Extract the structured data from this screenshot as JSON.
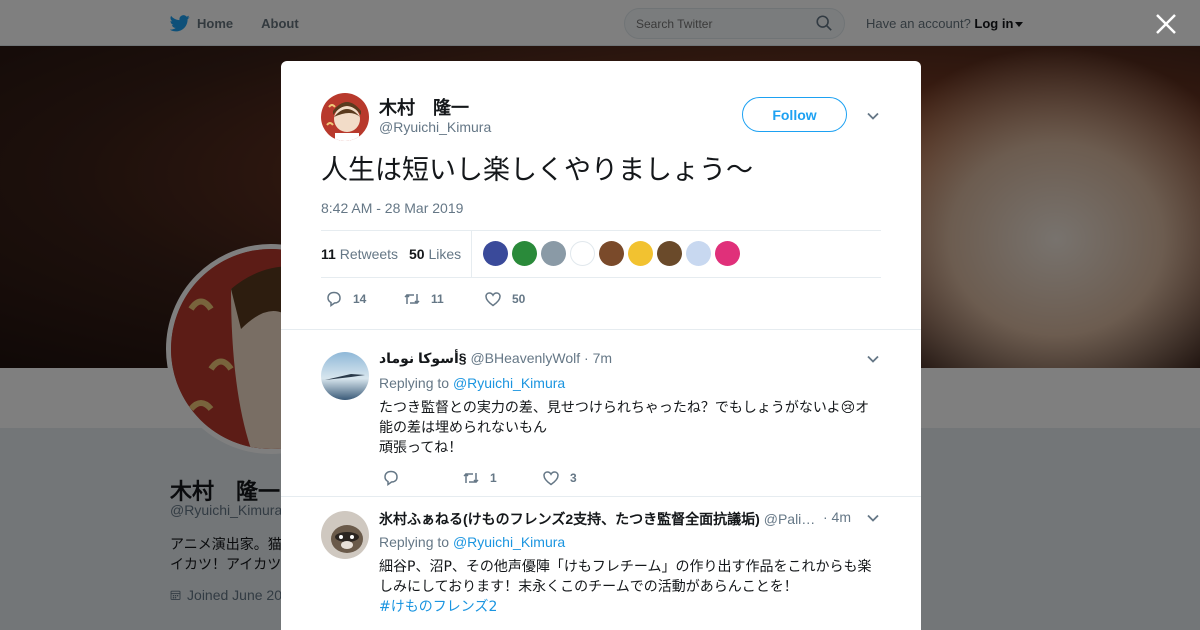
{
  "nav": {
    "home_label": "Home",
    "about_label": "About",
    "search_placeholder": "Search Twitter",
    "account_prompt": "Have an account?",
    "login_label": "Log in"
  },
  "background_profile": {
    "name": "木村　隆一",
    "handle": "@Ryuichi_Kimura",
    "bio_line1": "アニメ演出家。猫",
    "bio_line2": "イカツ！アイカツ",
    "joined": "Joined June 20"
  },
  "tweet": {
    "author_name": "木村　隆一",
    "author_handle": "@Ryuichi_Kimura",
    "follow_label": "Follow",
    "text": "人生は短いし楽しくやりましょう〜",
    "timestamp": "8:42 AM - 28 Mar 2019",
    "retweets_count": "11",
    "retweets_label": "Retweets",
    "likes_count": "50",
    "likes_label": "Likes",
    "reply_count": "14",
    "retweet_action_count": "11",
    "like_action_count": "50",
    "likers": [
      "#3a4a9a",
      "#2a8a3a",
      "#8a9aa6",
      "#ffffff",
      "#7a4a2a",
      "#f2c230",
      "#6a4a2a",
      "#c8d8f0",
      "#e0307a"
    ]
  },
  "replies": [
    {
      "name": "أسوكا نوماد§",
      "handle": "@BHeavenlyWolf",
      "time": "· 7m",
      "replying_label": "Replying to",
      "replying_to": "@Ryuichi_Kimura",
      "line1": "たつき監督との実力の差、見せつけられちゃったね？でもしょうがないよ😢オ",
      "line2": "能の差は埋められないもん",
      "line3": "頑張ってね！",
      "reply_count": "",
      "retweet_count": "1",
      "like_count": "3"
    },
    {
      "name": "氷村ふぁねる(けものフレンズ2支持、たつき監督全面抗議垢)",
      "handle": "@Pali…",
      "time": "· 4m",
      "replying_label": "Replying to",
      "replying_to": "@Ryuichi_Kimura",
      "line1": "細谷P、沼P、その他声優陣「けもフレチーム」の作り出す作品をこれからも楽",
      "line2": "しみにしております！末永くこのチームでの活動があらんことを！",
      "line3": "#けものフレンズ2"
    }
  ]
}
